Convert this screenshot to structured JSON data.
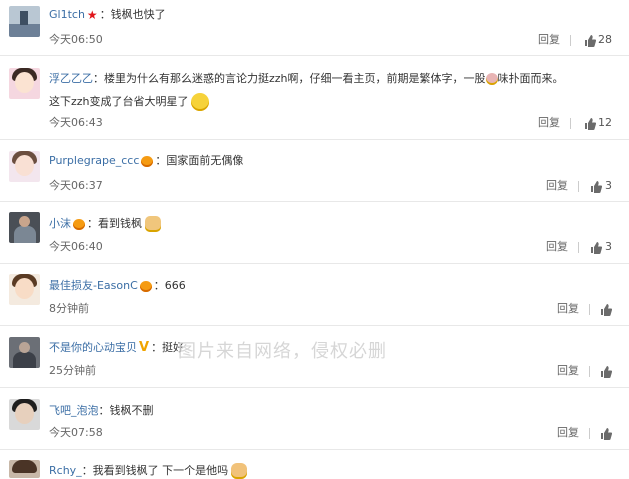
{
  "comments": [
    {
      "user": "Gl1tch",
      "text": "：钱枫也快了",
      "time": "今天06:50",
      "reply": "回复",
      "likes": "28"
    },
    {
      "user": "浮乙乙乙",
      "text": "：楼里为什么有那么迷惑的言论力挺zzh啊，仔细一看主页，前期是繁体字，一股",
      "text_b": "味扑面而来。",
      "text2": "这下zzh变成了台省大明星了",
      "time": "今天06:43",
      "reply": "回复",
      "likes": "12"
    },
    {
      "user": "Purplegrape_ccc",
      "text": "：国家面前无偶像",
      "time": "今天06:37",
      "reply": "回复",
      "likes": "3"
    },
    {
      "user": "小沫",
      "text": "：看到钱枫",
      "time": "今天06:40",
      "reply": "回复",
      "likes": "3"
    },
    {
      "user": "最佳损友-EasonC",
      "text": "：666",
      "time": "8分钟前",
      "reply": "回复"
    },
    {
      "user": "不是你的心动宝贝",
      "text": "：挺好",
      "time": "25分钟前",
      "reply": "回复"
    },
    {
      "user": "飞吧_泡泡",
      "text": "：钱枫不删",
      "time": "今天07:58",
      "reply": "回复"
    },
    {
      "user": "Rchy_",
      "text": "：我看到钱枫了 下一个是他吗"
    }
  ],
  "watermark": "图片来自网络，侵权必删",
  "icons": {
    "like": "thumbs-up-icon",
    "reply": "reply-link"
  }
}
